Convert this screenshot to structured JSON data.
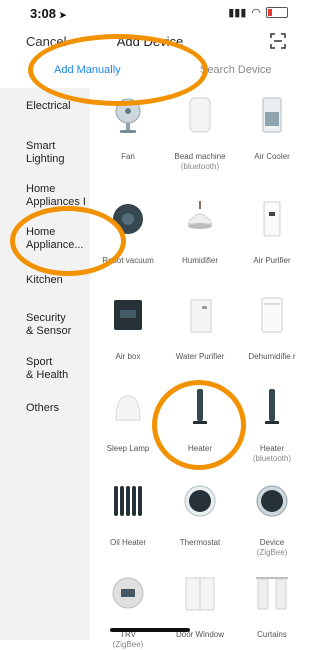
{
  "status": {
    "time": "3:08",
    "location_glyph": "➤"
  },
  "nav": {
    "cancel": "Cancel",
    "title": "Add Device"
  },
  "tabs": {
    "manual": "Add Manually",
    "search": "Search Device"
  },
  "categories": [
    "Electrical",
    "Smart\nLighting",
    "Home\nAppliances I",
    "Home\nAppliance...",
    "Kitchen",
    "Security\n& Sensor",
    "Sport\n& Health",
    "Others"
  ],
  "devices": [
    {
      "name": "Fan",
      "sub": ""
    },
    {
      "name": "Bead machine",
      "sub": "(bluetooth)"
    },
    {
      "name": "Air Cooler",
      "sub": ""
    },
    {
      "name": "Robot vacuum",
      "sub": ""
    },
    {
      "name": "Humidifier",
      "sub": ""
    },
    {
      "name": "Air Purifier",
      "sub": ""
    },
    {
      "name": "Air box",
      "sub": ""
    },
    {
      "name": "Water Purifier",
      "sub": ""
    },
    {
      "name": "Dehumidifie r",
      "sub": ""
    },
    {
      "name": "Sleep Lamp",
      "sub": ""
    },
    {
      "name": "Heater",
      "sub": ""
    },
    {
      "name": "Heater",
      "sub": "(bluetooth)"
    },
    {
      "name": "Oil Heater",
      "sub": ""
    },
    {
      "name": "Thermostat",
      "sub": ""
    },
    {
      "name": "Device",
      "sub": "(ZigBee)"
    },
    {
      "name": "TRV",
      "sub": "(ZigBee)"
    },
    {
      "name": "Door Window",
      "sub": ""
    },
    {
      "name": "Curtains",
      "sub": ""
    }
  ],
  "colors": {
    "accent": "#1e88e5",
    "highlight_ring": "#f39200",
    "sidebar_bg": "#f2f2f2"
  }
}
